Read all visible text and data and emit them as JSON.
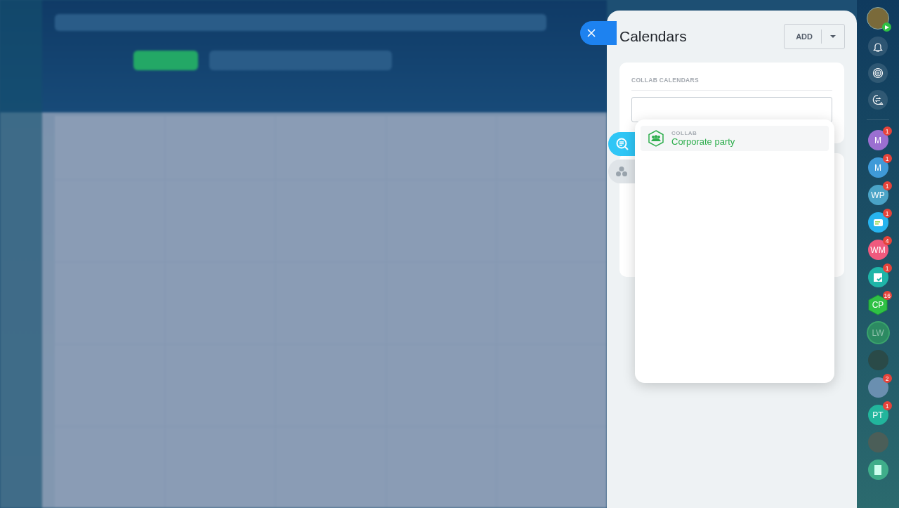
{
  "panel": {
    "title": "Calendars",
    "add_button": "ADD",
    "section_title": "COLLAB CALENDARS",
    "results": [
      {
        "kind": "collab",
        "type_label": "COLLAB",
        "name": "Corporate party"
      }
    ],
    "side_tabs": [
      {
        "kind": "search",
        "selected": true
      },
      {
        "kind": "groups",
        "selected": false
      }
    ]
  },
  "rightbar": {
    "items": [
      {
        "kind": "initials",
        "initials": "M",
        "color": "#9b6fd1",
        "badge": "1"
      },
      {
        "kind": "initials",
        "initials": "M",
        "color": "#3f9ad8",
        "badge": "1"
      },
      {
        "kind": "initials",
        "initials": "WP",
        "color": "#4aa3c6",
        "badge": "1"
      },
      {
        "kind": "chat",
        "color": "#27b4ef",
        "badge": "1"
      },
      {
        "kind": "initials",
        "initials": "WM",
        "color": "#f05a7e",
        "badge": "4"
      },
      {
        "kind": "task",
        "color": "#1fb5a8",
        "badge": "1"
      },
      {
        "kind": "hexagon",
        "initials": "CP",
        "color": "#2fc145",
        "badge": "16"
      },
      {
        "kind": "faded",
        "initials": "LW",
        "color": "#2c8a62"
      },
      {
        "kind": "photo",
        "color": "#2a4a48"
      },
      {
        "kind": "photo",
        "color": "#6a8fb0",
        "badge": "2"
      },
      {
        "kind": "initials",
        "initials": "PT",
        "color": "#22b59c",
        "badge": "1"
      },
      {
        "kind": "photo",
        "color": "#4b5e58"
      },
      {
        "kind": "doc",
        "color": "#3fae8a"
      }
    ]
  }
}
